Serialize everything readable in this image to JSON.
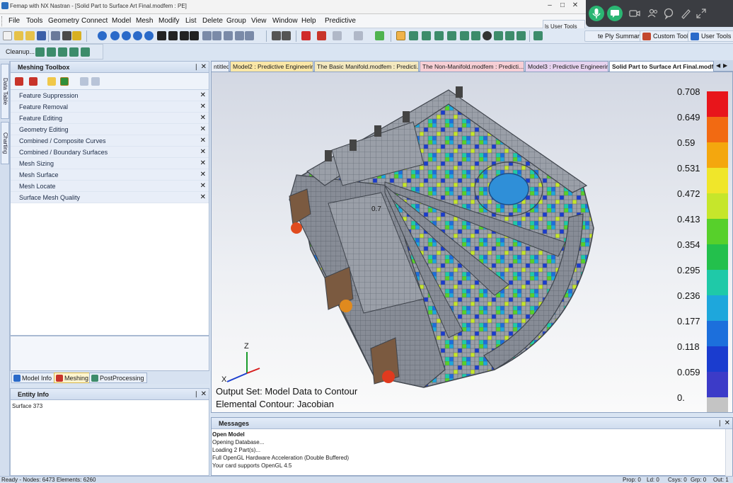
{
  "window": {
    "title": "Femap with NX Nastran - [Solid Part to Surface Art Final.modfem : PE]",
    "controls": [
      "–",
      "□",
      "✕"
    ]
  },
  "menu": [
    "File",
    "Tools",
    "Geometry",
    "Connect",
    "Model",
    "Mesh",
    "Modify",
    "List",
    "Delete",
    "Group",
    "View",
    "Window",
    "Help",
    "Predictive"
  ],
  "callbar": {
    "icons": [
      "microphone-icon",
      "chat-icon",
      "camera-icon",
      "people-icon",
      "comment-icon",
      "pen-icon",
      "expand-icon"
    ]
  },
  "toolbar": {
    "usertools_popup": "ls  User Tools",
    "ply_summary": "te Ply Summary",
    "custom_tools": "Custom Tools",
    "user_tools": "User Tools",
    "cleanup": "Cleanup..."
  },
  "side_tabs": [
    "Data Table",
    "Charting"
  ],
  "meshing_toolbox": {
    "title": "Meshing Toolbox",
    "pin": "❘",
    "close": "✕",
    "items": [
      "Feature Suppression",
      "Feature Removal",
      "Feature Editing",
      "Geometry Editing",
      "Combined / Composite Curves",
      "Combined / Boundary Surfaces",
      "Mesh Sizing",
      "Mesh Surface",
      "Mesh Locate",
      "Surface Mesh Quality"
    ],
    "item_close": "✕"
  },
  "panel_tabs": [
    "Model Info",
    "Meshing",
    "PostProcessing"
  ],
  "entity_info": {
    "title": "Entity Info",
    "text": "Surface 373"
  },
  "doc_tabs": [
    {
      "label": "ntitled",
      "color": "#e9eef6"
    },
    {
      "label": "Model2 : Predictive Engineering",
      "color": "#fbe7a6"
    },
    {
      "label": "The Basic Manifold.modfem : Predicti...",
      "color": "#f4e9bf"
    },
    {
      "label": "The Non-Manifold.modfem : Predicti...",
      "color": "#f7cfd5"
    },
    {
      "label": "Model3 : Predictive Engineering",
      "color": "#e6d3ef"
    },
    {
      "label": "Solid Part to Surface Art Final.modf...",
      "color": "#ffffff"
    }
  ],
  "viewport": {
    "output_set": "Output Set: Model Data to Contour",
    "contour": "Elemental Contour: Jacobian",
    "probe_label": "0.7",
    "triad": {
      "x": "X",
      "z": "Z"
    }
  },
  "legend": {
    "values": [
      "0.708",
      "0.649",
      "0.59",
      "0.531",
      "0.472",
      "0.413",
      "0.354",
      "0.295",
      "0.236",
      "0.177",
      "0.118",
      "0.059",
      "0."
    ],
    "colors": [
      "#e8151b",
      "#f26a12",
      "#f4a70e",
      "#f0e62a",
      "#c6e62b",
      "#57d02b",
      "#23c04c",
      "#1fc9a8",
      "#1ea7dc",
      "#1c6fdc",
      "#1a3ccf",
      "#3c3bc8",
      "#c4c4c4"
    ]
  },
  "messages": {
    "title": "Messages",
    "lines": [
      "Open Model",
      "Opening Database...",
      "Loading 2 Part(s)...",
      "Full OpenGL Hardware Acceleration (Double Buffered)",
      "Your card supports OpenGL 4.5"
    ]
  },
  "status": {
    "left": "Ready - Nodes: 6473  Elements: 6260",
    "prop": "Prop: 0",
    "ld": "Ld: 0",
    "csys": "Csys: 0",
    "grp": "Grp: 0",
    "out": "Out: 1"
  }
}
